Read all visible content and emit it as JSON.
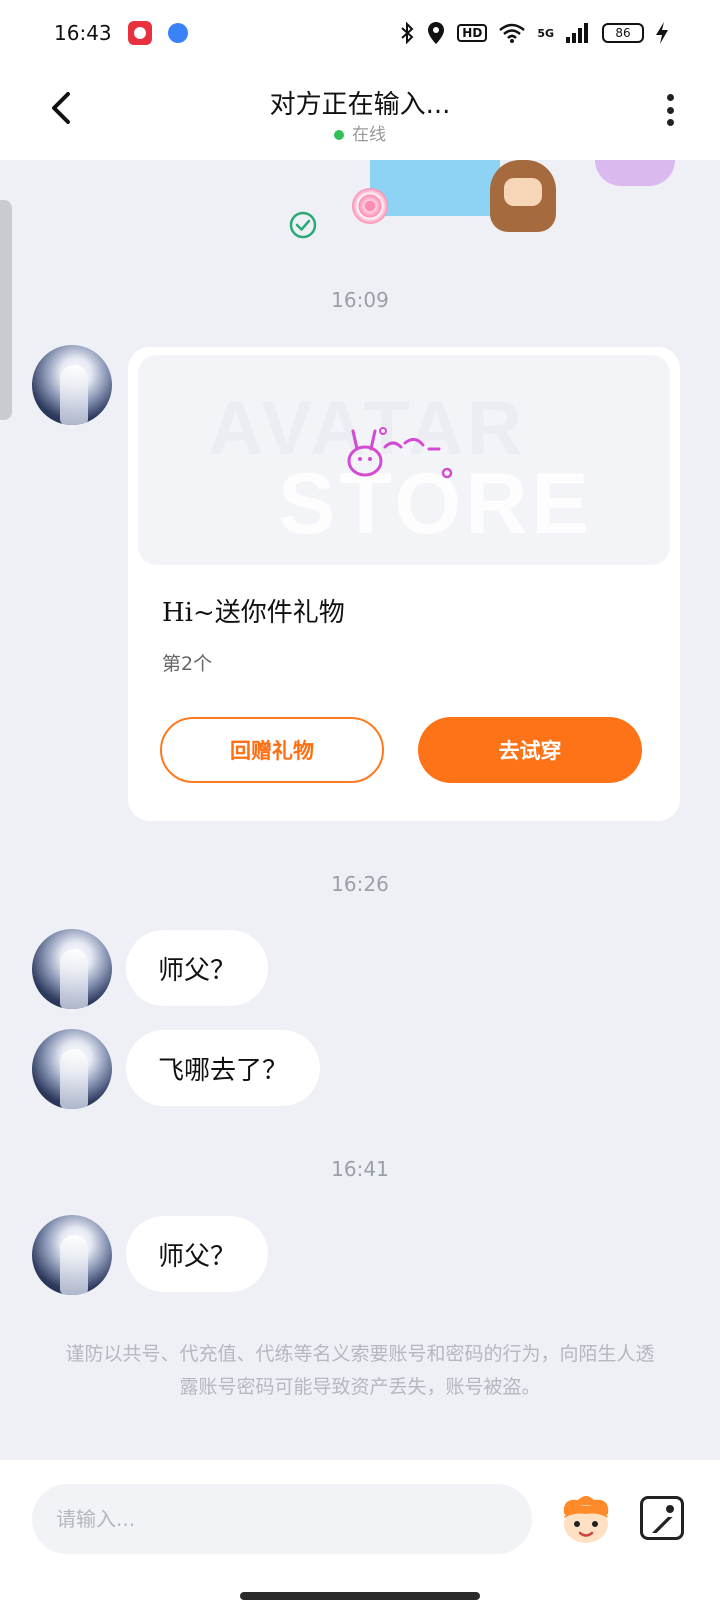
{
  "status_bar": {
    "time": "16:43",
    "net": "5G",
    "hd": "HD",
    "battery": "86"
  },
  "header": {
    "title": "对方正在输入...",
    "status": "在线"
  },
  "messages": {
    "time1": "16:09",
    "gift_card": {
      "watermark_line1": "AVATAR",
      "watermark_line2": "STORE",
      "title": "Hi~送你件礼物",
      "subtitle": "第2个",
      "return_gift_label": "回赠礼物",
      "try_on_label": "去试穿"
    },
    "time2": "16:26",
    "bubble1": "师父？",
    "bubble2": "飞哪去了？",
    "time3": "16:41",
    "bubble3": "师父？"
  },
  "notice": "谨防以共号、代充值、代练等名义索要账号和密码的行为，向陌生人透露账号密码可能导致资产丢失，账号被盗。",
  "input": {
    "placeholder": "请输入..."
  },
  "colors": {
    "accent": "#ff7318",
    "online": "#33c057",
    "background": "#eef0f6"
  }
}
